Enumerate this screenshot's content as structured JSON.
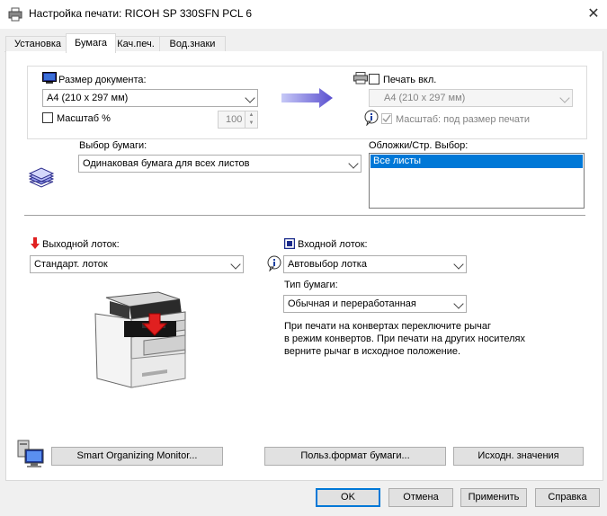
{
  "window": {
    "title": "Настройка печати: RICOH SP 330SFN PCL 6"
  },
  "tabs": [
    "Установка",
    "Бумага",
    "Кач.печ.",
    "Вод.знаки"
  ],
  "doc_size": {
    "label": "Размер документа:",
    "value": "A4 (210 x 297 мм)",
    "scale_label": "Масштаб %",
    "scale_value": "100"
  },
  "print_on": {
    "label": "Печать вкл.",
    "value": "A4 (210 x 297 мм)",
    "fit_label": "Масштаб: под размер печати"
  },
  "paper_select": {
    "label": "Выбор бумаги:",
    "value": "Одинаковая бумага для всех листов"
  },
  "covers": {
    "label": "Обложки/Стр. Выбор:",
    "items": [
      "Все листы"
    ]
  },
  "output_tray": {
    "label": "Выходной лоток:",
    "value": "Стандарт. лоток"
  },
  "input_tray": {
    "label": "Входной лоток:",
    "value": "Автовыбор лотка"
  },
  "paper_type": {
    "label": "Тип бумаги:",
    "value": "Обычная и переработанная"
  },
  "info": {
    "lines": [
      "При печати на конвертах переключите рычаг",
      "в режим конвертов. При печати на других носителях",
      "верните рычаг в исходное положение."
    ]
  },
  "buttons": {
    "smart_monitor": "Smart Organizing Monitor...",
    "custom_paper": "Польз.формат бумаги...",
    "defaults": "Исходн. значения",
    "ok": "OK",
    "cancel": "Отмена",
    "apply": "Применить",
    "help": "Справка"
  },
  "icons": [
    "printer-icon",
    "close-icon",
    "monitor-icon",
    "printer-small-icon",
    "arrow-right-icon",
    "info-icon",
    "paper-stack-icon",
    "red-arrow-down-icon",
    "tray-icon",
    "device-image",
    "computer-icon"
  ],
  "colors": {
    "accent": "#0078d7",
    "arrow_blue": "#5a4fcf",
    "red": "#e02020"
  }
}
